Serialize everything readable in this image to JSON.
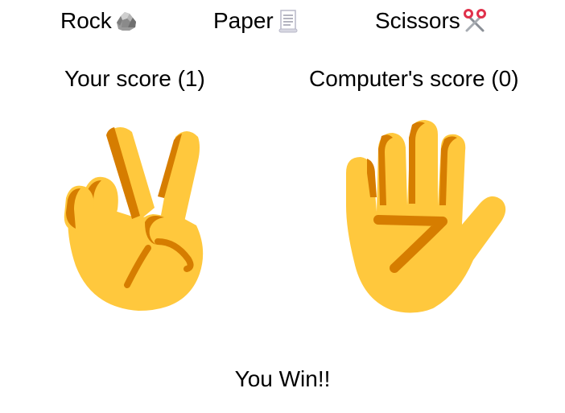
{
  "choices": [
    {
      "label": "Rock",
      "icon": "rock-icon"
    },
    {
      "label": "Paper",
      "icon": "scroll-icon"
    },
    {
      "label": "Scissors",
      "icon": "scissors-icon"
    }
  ],
  "scores": {
    "player_label": "Your score (1)",
    "computer_label": "Computer's score (0)"
  },
  "hands": {
    "player": "victory-hand-icon",
    "computer": "raised-hand-icon"
  },
  "result": "You Win!!",
  "colors": {
    "hand_fill": "#FFC83D",
    "hand_shade": "#D67D00",
    "text": "#000000"
  }
}
